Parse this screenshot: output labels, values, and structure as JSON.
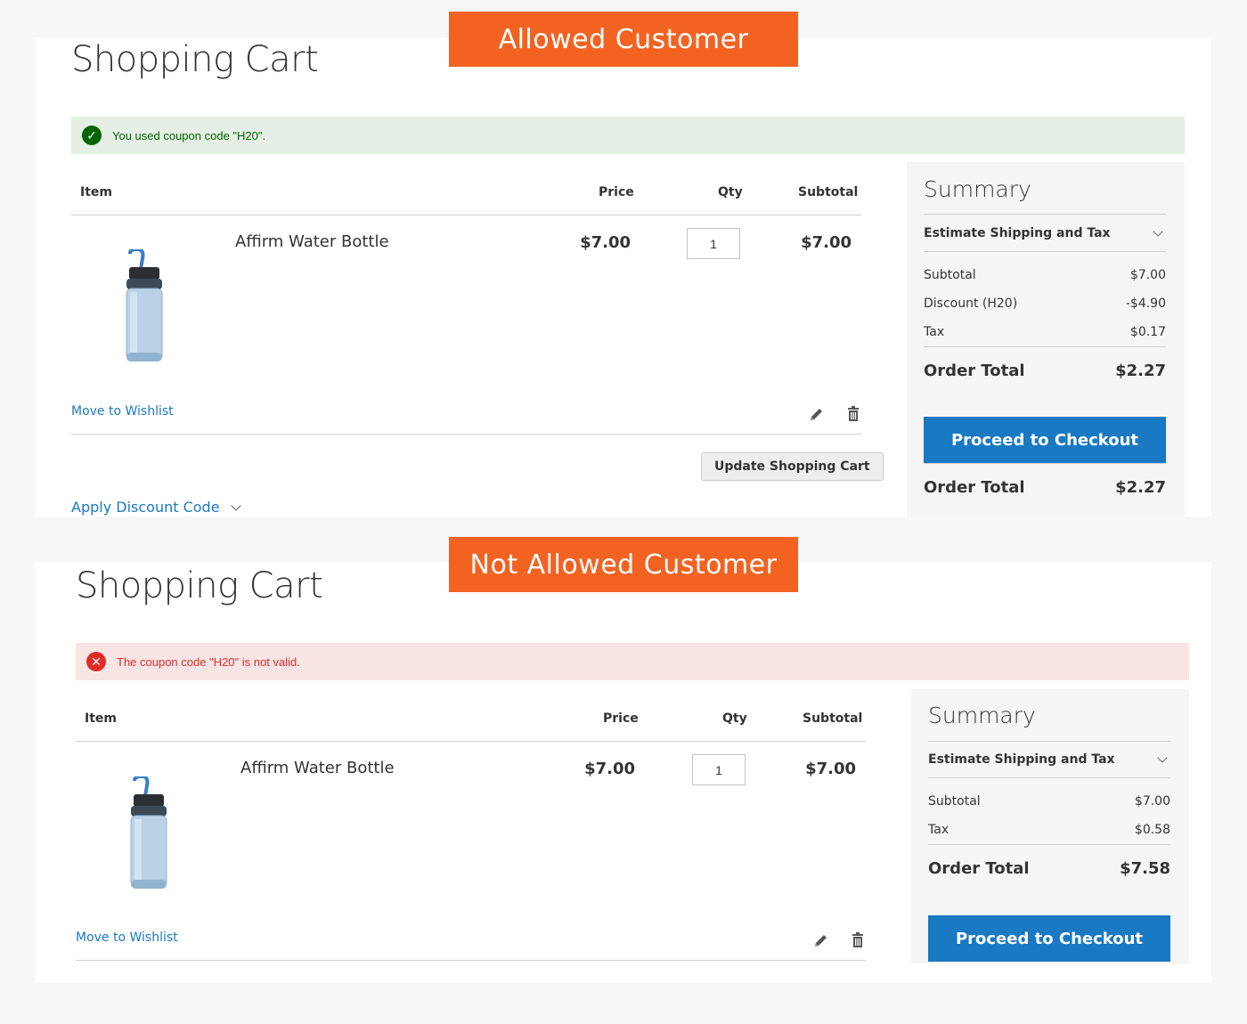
{
  "banners": {
    "allowed": "Allowed Customer",
    "not_allowed": "Not Allowed Customer"
  },
  "colors": {
    "accent": "#f26322",
    "link": "#1979c3",
    "success": "#006400",
    "error": "#e02b27"
  },
  "cart_a": {
    "title": "Shopping Cart",
    "message": "You used coupon code \"H20\".",
    "headers": {
      "item": "Item",
      "price": "Price",
      "qty": "Qty",
      "subtotal": "Subtotal"
    },
    "item": {
      "name": "Affirm Water Bottle",
      "price": "$7.00",
      "qty": "1",
      "subtotal": "$7.00"
    },
    "move_to_wishlist": "Move to Wishlist",
    "update_button": "Update Shopping Cart",
    "apply_discount": "Apply Discount Code",
    "summary": {
      "title": "Summary",
      "estimate": "Estimate Shipping and Tax",
      "subtotal_label": "Subtotal",
      "subtotal_value": "$7.00",
      "discount_label": "Discount (H20)",
      "discount_value": "-$4.90",
      "tax_label": "Tax",
      "tax_value": "$0.17",
      "total_label": "Order Total",
      "total_value": "$2.27",
      "checkout": "Proceed to Checkout"
    }
  },
  "cart_b": {
    "title": "Shopping Cart",
    "message": "The coupon code \"H20\" is not valid.",
    "headers": {
      "item": "Item",
      "price": "Price",
      "qty": "Qty",
      "subtotal": "Subtotal"
    },
    "item": {
      "name": "Affirm Water Bottle",
      "price": "$7.00",
      "qty": "1",
      "subtotal": "$7.00"
    },
    "move_to_wishlist": "Move to Wishlist",
    "summary": {
      "title": "Summary",
      "estimate": "Estimate Shipping and Tax",
      "subtotal_label": "Subtotal",
      "subtotal_value": "$7.00",
      "tax_label": "Tax",
      "tax_value": "$0.58",
      "total_label": "Order Total",
      "total_value": "$7.58",
      "checkout": "Proceed to Checkout"
    }
  }
}
